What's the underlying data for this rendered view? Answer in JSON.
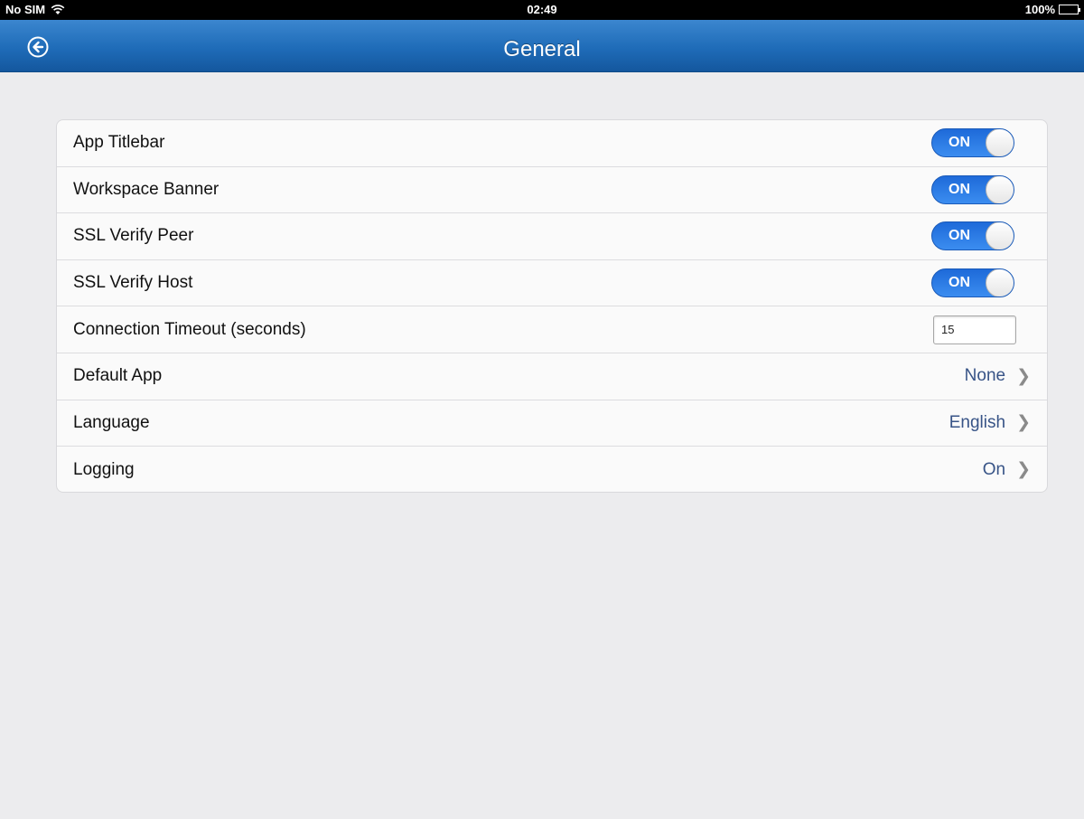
{
  "status_bar": {
    "carrier": "No SIM",
    "time": "02:49",
    "battery": "100%"
  },
  "nav": {
    "title": "General",
    "back_icon": "back-arrow-circle-icon"
  },
  "settings": {
    "app_titlebar": {
      "label": "App Titlebar",
      "state": "ON"
    },
    "workspace_banner": {
      "label": "Workspace Banner",
      "state": "ON"
    },
    "ssl_verify_peer": {
      "label": "SSL Verify Peer",
      "state": "ON"
    },
    "ssl_verify_host": {
      "label": "SSL Verify Host",
      "state": "ON"
    },
    "connection_timeout": {
      "label": "Connection Timeout (seconds)",
      "value": "15"
    },
    "default_app": {
      "label": "Default App",
      "value": "None"
    },
    "language": {
      "label": "Language",
      "value": "English"
    },
    "logging": {
      "label": "Logging",
      "value": "On"
    }
  },
  "colors": {
    "nav_blue": "#1f6cb8",
    "toggle_blue": "#2a7be4",
    "value_blue": "#385487",
    "background": "#ececee"
  }
}
